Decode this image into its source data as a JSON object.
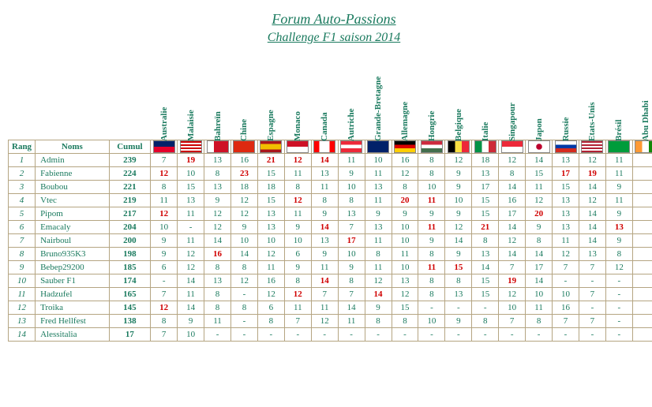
{
  "title": "Forum Auto-Passions",
  "subtitle": "Challenge F1 saison 2014",
  "headers": {
    "rang": "Rang",
    "noms": "Noms",
    "cumul": "Cumul"
  },
  "races": [
    {
      "name": "Australie",
      "flag": "linear-gradient(#012169 50%,#e4002b 50%)"
    },
    {
      "name": "Malaisie",
      "flag": "repeating-linear-gradient(#cc0001 0 2px,#fff 2px 4px)"
    },
    {
      "name": "Bahreïn",
      "flag": "linear-gradient(90deg,#fff 30%,#ce1126 30%)"
    },
    {
      "name": "Chine",
      "flag": "#de2910"
    },
    {
      "name": "Espagne",
      "flag": "linear-gradient(#aa151b 25%,#f1bf00 25% 75%,#aa151b 75%)"
    },
    {
      "name": "Monaco",
      "flag": "linear-gradient(#ce1126 50%,#fff 50%)"
    },
    {
      "name": "Canada",
      "flag": "linear-gradient(90deg,#ff0000 25%,#fff 25% 75%,#ff0000 75%)"
    },
    {
      "name": "Autriche",
      "flag": "linear-gradient(#ed2939 33%,#fff 33% 66%,#ed2939 66%)"
    },
    {
      "name": "Grande-Bretagne",
      "flag": "linear-gradient(#012169,#012169)"
    },
    {
      "name": "Allemagne",
      "flag": "linear-gradient(#000 33%,#dd0000 33% 66%,#ffce00 66%)"
    },
    {
      "name": "Hongrie",
      "flag": "linear-gradient(#cd2a3e 33%,#fff 33% 66%,#436f4d 66%)"
    },
    {
      "name": "Belgique",
      "flag": "linear-gradient(90deg,#000 33%,#fae042 33% 66%,#ed2939 66%)"
    },
    {
      "name": "Italie",
      "flag": "linear-gradient(90deg,#009246 33%,#fff 33% 66%,#ce2b37 66%)"
    },
    {
      "name": "Singapour",
      "flag": "linear-gradient(#ed2939 50%,#fff 50%)"
    },
    {
      "name": "Japon",
      "flag": "radial-gradient(circle,#bc002d 25%,#fff 26%)"
    },
    {
      "name": "Russie",
      "flag": "linear-gradient(#fff 33%,#0039a6 33% 66%,#d52b1e 66%)"
    },
    {
      "name": "Etats-Unis",
      "flag": "repeating-linear-gradient(#b22234 0 2px,#fff 2px 4px)"
    },
    {
      "name": "Brésil",
      "flag": "#009c3b"
    },
    {
      "name": "Abu Dhabi",
      "flag": "linear-gradient(90deg,#ff9933 33%,#fff 33% 66%,#138808 66%)"
    }
  ],
  "rows": [
    {
      "rank": 1,
      "name": "Admin",
      "cumul": 239,
      "scores": [
        {
          "v": 7
        },
        {
          "v": 19,
          "r": 1
        },
        {
          "v": 13
        },
        {
          "v": 16
        },
        {
          "v": 21,
          "r": 1
        },
        {
          "v": 12,
          "r": 1
        },
        {
          "v": 14,
          "r": 1
        },
        {
          "v": 11
        },
        {
          "v": 10
        },
        {
          "v": 16
        },
        {
          "v": 8
        },
        {
          "v": 12
        },
        {
          "v": 18
        },
        {
          "v": 12
        },
        {
          "v": 14
        },
        {
          "v": 13
        },
        {
          "v": 12
        },
        {
          "v": 11
        },
        {
          "v": ""
        }
      ]
    },
    {
      "rank": 2,
      "name": "Fabienne",
      "cumul": 224,
      "scores": [
        {
          "v": 12,
          "r": 1
        },
        {
          "v": 10
        },
        {
          "v": 8
        },
        {
          "v": 23,
          "r": 1
        },
        {
          "v": 15
        },
        {
          "v": 11
        },
        {
          "v": 13
        },
        {
          "v": 9
        },
        {
          "v": 11
        },
        {
          "v": 12
        },
        {
          "v": 8
        },
        {
          "v": 9
        },
        {
          "v": 13
        },
        {
          "v": 8
        },
        {
          "v": 15
        },
        {
          "v": 17,
          "r": 1
        },
        {
          "v": 19,
          "r": 1
        },
        {
          "v": 11
        },
        {
          "v": ""
        }
      ]
    },
    {
      "rank": 3,
      "name": "Boubou",
      "cumul": 221,
      "scores": [
        {
          "v": 8
        },
        {
          "v": 15
        },
        {
          "v": 13
        },
        {
          "v": 18
        },
        {
          "v": 18
        },
        {
          "v": 8
        },
        {
          "v": 11
        },
        {
          "v": 10
        },
        {
          "v": 13
        },
        {
          "v": 8
        },
        {
          "v": 10
        },
        {
          "v": 9
        },
        {
          "v": 17
        },
        {
          "v": 14
        },
        {
          "v": 11
        },
        {
          "v": 15
        },
        {
          "v": 14
        },
        {
          "v": 9
        },
        {
          "v": ""
        }
      ]
    },
    {
      "rank": 4,
      "name": "Vtec",
      "cumul": 219,
      "scores": [
        {
          "v": 11
        },
        {
          "v": 13
        },
        {
          "v": 9
        },
        {
          "v": 12
        },
        {
          "v": 15
        },
        {
          "v": 12,
          "r": 1
        },
        {
          "v": 8
        },
        {
          "v": 8
        },
        {
          "v": 11
        },
        {
          "v": 20,
          "r": 1
        },
        {
          "v": 11,
          "r": 1
        },
        {
          "v": 10
        },
        {
          "v": 15
        },
        {
          "v": 16
        },
        {
          "v": 12
        },
        {
          "v": 13
        },
        {
          "v": 12
        },
        {
          "v": 11
        },
        {
          "v": ""
        }
      ]
    },
    {
      "rank": 5,
      "name": "Pipom",
      "cumul": 217,
      "scores": [
        {
          "v": 12,
          "r": 1
        },
        {
          "v": 11
        },
        {
          "v": 12
        },
        {
          "v": 12
        },
        {
          "v": 13
        },
        {
          "v": 11
        },
        {
          "v": 9
        },
        {
          "v": 13
        },
        {
          "v": 9
        },
        {
          "v": 9
        },
        {
          "v": 9
        },
        {
          "v": 9
        },
        {
          "v": 15
        },
        {
          "v": 17
        },
        {
          "v": 20,
          "r": 1
        },
        {
          "v": 13
        },
        {
          "v": 14
        },
        {
          "v": 9
        },
        {
          "v": ""
        }
      ]
    },
    {
      "rank": 6,
      "name": "Emacaly",
      "cumul": 204,
      "scores": [
        {
          "v": 10
        },
        {
          "v": "-"
        },
        {
          "v": 12
        },
        {
          "v": 9
        },
        {
          "v": 13
        },
        {
          "v": 9
        },
        {
          "v": 14,
          "r": 1
        },
        {
          "v": 7
        },
        {
          "v": 13
        },
        {
          "v": 10
        },
        {
          "v": 11,
          "r": 1
        },
        {
          "v": 12
        },
        {
          "v": 21,
          "r": 1
        },
        {
          "v": 14
        },
        {
          "v": 9
        },
        {
          "v": 13
        },
        {
          "v": 14
        },
        {
          "v": 13,
          "r": 1
        },
        {
          "v": ""
        }
      ]
    },
    {
      "rank": 7,
      "name": "Nairboul",
      "cumul": 200,
      "scores": [
        {
          "v": 9
        },
        {
          "v": 11
        },
        {
          "v": 14
        },
        {
          "v": 10
        },
        {
          "v": 10
        },
        {
          "v": 10
        },
        {
          "v": 13
        },
        {
          "v": 17,
          "r": 1
        },
        {
          "v": 11
        },
        {
          "v": 10
        },
        {
          "v": 9
        },
        {
          "v": 14
        },
        {
          "v": 8
        },
        {
          "v": 12
        },
        {
          "v": 8
        },
        {
          "v": 11
        },
        {
          "v": 14
        },
        {
          "v": 9
        },
        {
          "v": ""
        }
      ]
    },
    {
      "rank": 8,
      "name": "Bruno935K3",
      "cumul": 198,
      "scores": [
        {
          "v": 9
        },
        {
          "v": 12
        },
        {
          "v": 16,
          "r": 1
        },
        {
          "v": 14
        },
        {
          "v": 12
        },
        {
          "v": 6
        },
        {
          "v": 9
        },
        {
          "v": 10
        },
        {
          "v": 8
        },
        {
          "v": 11
        },
        {
          "v": 8
        },
        {
          "v": 9
        },
        {
          "v": 13
        },
        {
          "v": 14
        },
        {
          "v": 14
        },
        {
          "v": 12
        },
        {
          "v": 13
        },
        {
          "v": 8
        },
        {
          "v": ""
        }
      ]
    },
    {
      "rank": 9,
      "name": "Bebep29200",
      "cumul": 185,
      "scores": [
        {
          "v": 6
        },
        {
          "v": 12
        },
        {
          "v": 8
        },
        {
          "v": 8
        },
        {
          "v": 11
        },
        {
          "v": 9
        },
        {
          "v": 11
        },
        {
          "v": 9
        },
        {
          "v": 11
        },
        {
          "v": 10
        },
        {
          "v": 11,
          "r": 1
        },
        {
          "v": 15,
          "r": 1
        },
        {
          "v": 14
        },
        {
          "v": 7
        },
        {
          "v": 17
        },
        {
          "v": 7
        },
        {
          "v": 7
        },
        {
          "v": 12
        },
        {
          "v": ""
        }
      ]
    },
    {
      "rank": 10,
      "name": "Sauber F1",
      "cumul": 174,
      "scores": [
        {
          "v": "-"
        },
        {
          "v": 14
        },
        {
          "v": 13
        },
        {
          "v": 12
        },
        {
          "v": 16
        },
        {
          "v": 8
        },
        {
          "v": 14,
          "r": 1
        },
        {
          "v": 8
        },
        {
          "v": 12
        },
        {
          "v": 13
        },
        {
          "v": 8
        },
        {
          "v": 8
        },
        {
          "v": 15
        },
        {
          "v": 19,
          "r": 1
        },
        {
          "v": 14
        },
        {
          "v": "-"
        },
        {
          "v": "-"
        },
        {
          "v": "-"
        },
        {
          "v": ""
        }
      ]
    },
    {
      "rank": 11,
      "name": "Hadzufel",
      "cumul": 165,
      "scores": [
        {
          "v": 7
        },
        {
          "v": 11
        },
        {
          "v": 8
        },
        {
          "v": "-"
        },
        {
          "v": 12
        },
        {
          "v": 12,
          "r": 1
        },
        {
          "v": 7
        },
        {
          "v": 7
        },
        {
          "v": 14,
          "r": 1
        },
        {
          "v": 12
        },
        {
          "v": 8
        },
        {
          "v": 13
        },
        {
          "v": 15
        },
        {
          "v": 12
        },
        {
          "v": 10
        },
        {
          "v": 10
        },
        {
          "v": 7
        },
        {
          "v": "-"
        },
        {
          "v": ""
        }
      ]
    },
    {
      "rank": 12,
      "name": "Troika",
      "cumul": 145,
      "scores": [
        {
          "v": 12,
          "r": 1
        },
        {
          "v": 14
        },
        {
          "v": 8
        },
        {
          "v": 8
        },
        {
          "v": 6
        },
        {
          "v": 11
        },
        {
          "v": 11
        },
        {
          "v": 14
        },
        {
          "v": 9
        },
        {
          "v": 15
        },
        {
          "v": "-"
        },
        {
          "v": "-"
        },
        {
          "v": "-"
        },
        {
          "v": 10
        },
        {
          "v": 11
        },
        {
          "v": 16
        },
        {
          "v": "-"
        },
        {
          "v": "-"
        },
        {
          "v": ""
        }
      ]
    },
    {
      "rank": 13,
      "name": "Fred Hellfest",
      "cumul": 138,
      "scores": [
        {
          "v": 8
        },
        {
          "v": 9
        },
        {
          "v": 11
        },
        {
          "v": "-"
        },
        {
          "v": 8
        },
        {
          "v": 7
        },
        {
          "v": 12
        },
        {
          "v": 11
        },
        {
          "v": 8
        },
        {
          "v": 8
        },
        {
          "v": 10
        },
        {
          "v": 9
        },
        {
          "v": 8
        },
        {
          "v": 7
        },
        {
          "v": 8
        },
        {
          "v": 7
        },
        {
          "v": 7
        },
        {
          "v": "-"
        },
        {
          "v": ""
        }
      ]
    },
    {
      "rank": 14,
      "name": "Alessitalia",
      "cumul": 17,
      "scores": [
        {
          "v": 7
        },
        {
          "v": 10
        },
        {
          "v": "-"
        },
        {
          "v": "-"
        },
        {
          "v": "-"
        },
        {
          "v": "-"
        },
        {
          "v": "-"
        },
        {
          "v": "-"
        },
        {
          "v": "-"
        },
        {
          "v": "-"
        },
        {
          "v": "-"
        },
        {
          "v": "-"
        },
        {
          "v": "-"
        },
        {
          "v": "-"
        },
        {
          "v": "-"
        },
        {
          "v": "-"
        },
        {
          "v": "-"
        },
        {
          "v": "-"
        },
        {
          "v": ""
        }
      ]
    }
  ]
}
